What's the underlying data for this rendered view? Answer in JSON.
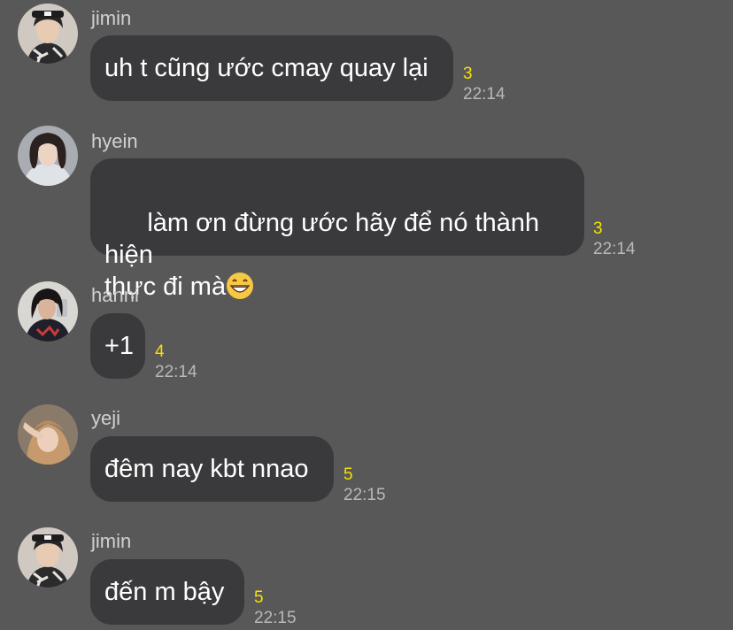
{
  "messages": [
    {
      "sender": "jimin",
      "avatar_icon": "profile-photo-jimin",
      "text": "uh t cũng ước cmay quay lại",
      "unread": "3",
      "time": "22:14"
    },
    {
      "sender": "hyein",
      "avatar_icon": "profile-photo-hyein",
      "text_line1": "làm ơn đừng ước hãy để nó thành hiện",
      "text_line2": "thực đi mà",
      "emoji": "grinning-face-emoji",
      "unread": "3",
      "time": "22:14"
    },
    {
      "sender": "hanni",
      "avatar_icon": "profile-photo-hanni",
      "text": "+1",
      "unread": "4",
      "time": "22:14"
    },
    {
      "sender": "yeji",
      "avatar_icon": "profile-photo-yeji",
      "text": "đêm nay kbt nnao",
      "unread": "5",
      "time": "22:15"
    },
    {
      "sender": "jimin",
      "avatar_icon": "profile-photo-jimin",
      "text": "đến m bậy",
      "unread": "5",
      "time": "22:15"
    }
  ],
  "colors": {
    "background": "#595859",
    "bubble": "#3a393b",
    "unread": "#f7e000",
    "time": "#b9b8b9"
  }
}
